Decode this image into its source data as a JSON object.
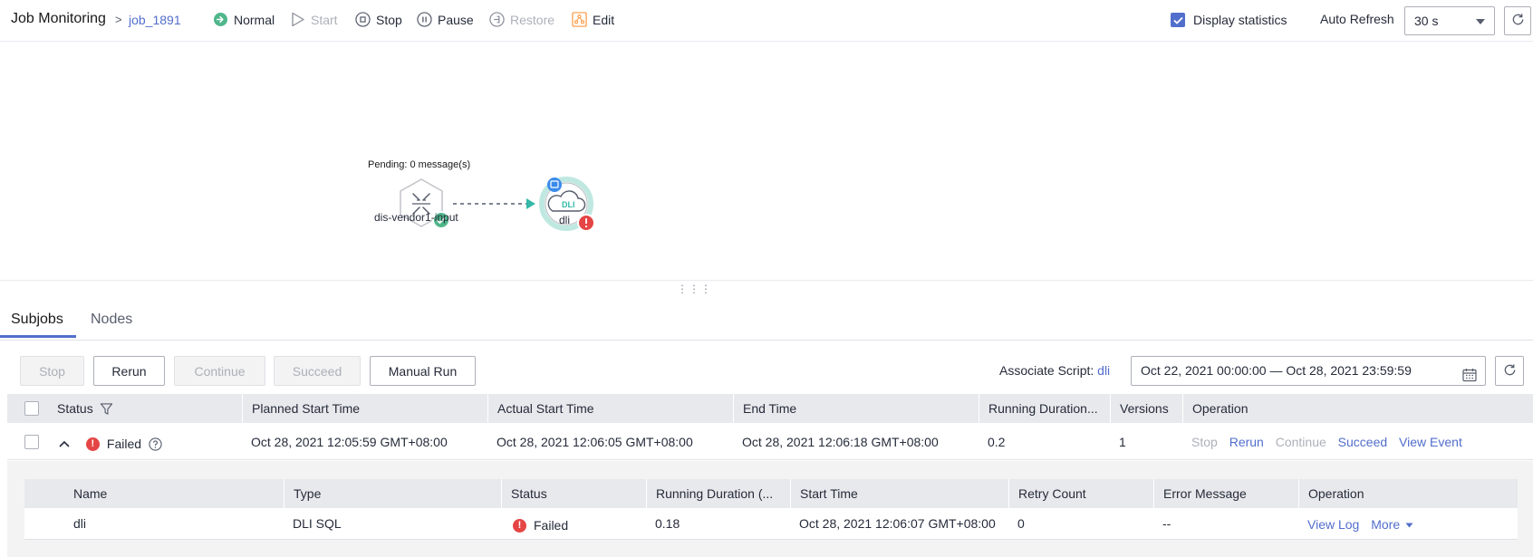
{
  "header": {
    "title": "Job Monitoring",
    "crumb_separator": ">",
    "job_name": "job_1891",
    "state": "Normal",
    "toolbar": {
      "start": "Start",
      "stop": "Stop",
      "pause": "Pause",
      "restore": "Restore",
      "edit": "Edit"
    },
    "display_statistics": "Display statistics",
    "display_statistics_checked": true,
    "auto_refresh_label": "Auto Refresh",
    "auto_refresh_value": "30 s"
  },
  "canvas": {
    "pending": "Pending: 0 message(s)",
    "source_node": "dis-vendor1-input",
    "target_node": "dli",
    "target_badge": "DLI",
    "drag_handle": "⋮⋮⋮"
  },
  "tabs": [
    "Subjobs",
    "Nodes"
  ],
  "actions": {
    "stop": "Stop",
    "rerun": "Rerun",
    "continue": "Continue",
    "succeed": "Succeed",
    "manual_run": "Manual Run",
    "associate_label": "Associate Script:",
    "associate_link": "dli",
    "date_range": "Oct 22, 2021 00:00:00 — Oct 28, 2021 23:59:59"
  },
  "table": {
    "columns": [
      "Status",
      "Planned Start Time",
      "Actual Start Time",
      "End Time",
      "Running Duration...",
      "Versions",
      "Operation"
    ],
    "row": {
      "status": "Failed",
      "planned_start": "Oct 28, 2021 12:05:59 GMT+08:00",
      "actual_start": "Oct 28, 2021 12:06:05 GMT+08:00",
      "end_time": "Oct 28, 2021 12:06:18 GMT+08:00",
      "duration": "0.2",
      "versions": "1",
      "ops": [
        "Stop",
        "Rerun",
        "Continue",
        "Succeed",
        "View Event"
      ]
    }
  },
  "subtable": {
    "columns": [
      "Name",
      "Type",
      "Status",
      "Running Duration (...",
      "Start Time",
      "Retry Count",
      "Error Message",
      "Operation"
    ],
    "row": {
      "name": "dli",
      "type": "DLI SQL",
      "status": "Failed",
      "duration": "0.18",
      "start_time": "Oct 28, 2021 12:06:07 GMT+08:00",
      "retry": "0",
      "error": "--",
      "ops": [
        "View Log",
        "More"
      ]
    }
  },
  "colors": {
    "accent": "#526ecc",
    "success": "#50b68b",
    "danger": "#e54545",
    "warning": "#fa9841"
  }
}
